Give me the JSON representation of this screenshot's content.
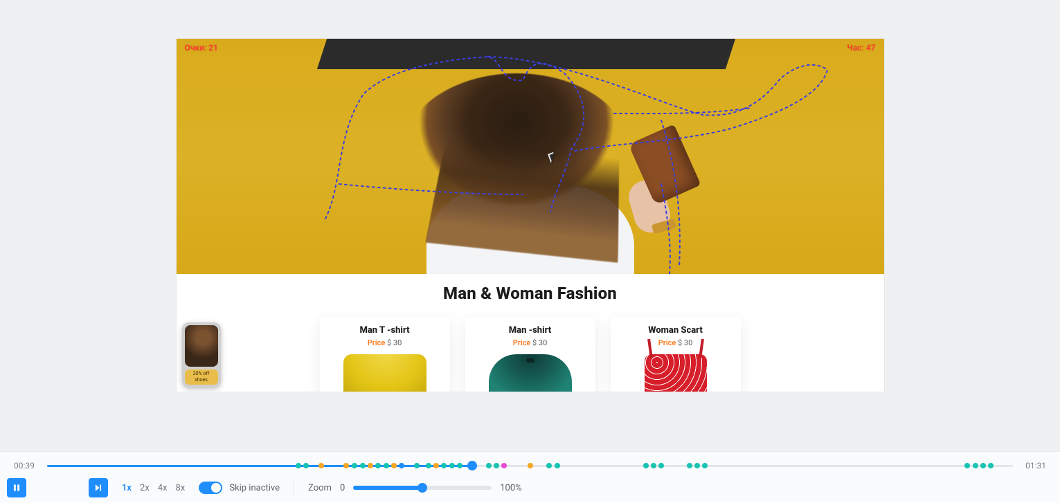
{
  "hero": {
    "overlay_top_left": "Очки: 21",
    "overlay_top_right": "Час: 47"
  },
  "section_title": "Man & Woman Fashion",
  "products": [
    {
      "title": "Man T -shirt",
      "price_label": "Price",
      "price_value": "$ 30",
      "swatch": "yellow"
    },
    {
      "title": "Man -shirt",
      "price_label": "Price",
      "price_value": "$ 30",
      "swatch": "green"
    },
    {
      "title": "Woman Scart",
      "price_label": "Price",
      "price_value": "$ 30",
      "swatch": "red"
    }
  ],
  "preview_thumb": {
    "line1": "20% off",
    "line2": "shoes"
  },
  "player": {
    "current_time": "00:39",
    "total_time": "01:31",
    "progress_pct": 44,
    "timeline_markers": [
      {
        "pct": 26.0,
        "c": "teal"
      },
      {
        "pct": 26.8,
        "c": "teal"
      },
      {
        "pct": 28.4,
        "c": "orange"
      },
      {
        "pct": 31.0,
        "c": "orange"
      },
      {
        "pct": 31.8,
        "c": "teal"
      },
      {
        "pct": 32.7,
        "c": "teal"
      },
      {
        "pct": 33.5,
        "c": "orange"
      },
      {
        "pct": 34.3,
        "c": "teal"
      },
      {
        "pct": 35.1,
        "c": "teal"
      },
      {
        "pct": 35.9,
        "c": "orange"
      },
      {
        "pct": 36.7,
        "c": "blue"
      },
      {
        "pct": 38.3,
        "c": "teal"
      },
      {
        "pct": 39.5,
        "c": "teal"
      },
      {
        "pct": 40.3,
        "c": "orange"
      },
      {
        "pct": 41.1,
        "c": "teal"
      },
      {
        "pct": 41.9,
        "c": "teal"
      },
      {
        "pct": 42.7,
        "c": "teal"
      },
      {
        "pct": 45.7,
        "c": "teal"
      },
      {
        "pct": 46.5,
        "c": "teal"
      },
      {
        "pct": 47.3,
        "c": "pink"
      },
      {
        "pct": 50.0,
        "c": "orange"
      },
      {
        "pct": 52.0,
        "c": "teal"
      },
      {
        "pct": 52.8,
        "c": "teal"
      },
      {
        "pct": 62.0,
        "c": "teal"
      },
      {
        "pct": 62.8,
        "c": "teal"
      },
      {
        "pct": 63.6,
        "c": "teal"
      },
      {
        "pct": 66.5,
        "c": "teal"
      },
      {
        "pct": 67.3,
        "c": "teal"
      },
      {
        "pct": 68.1,
        "c": "teal"
      },
      {
        "pct": 95.3,
        "c": "teal"
      },
      {
        "pct": 96.1,
        "c": "teal"
      },
      {
        "pct": 96.9,
        "c": "teal"
      },
      {
        "pct": 97.7,
        "c": "teal"
      }
    ],
    "speeds": [
      "1x",
      "2x",
      "4x",
      "8x"
    ],
    "speed_active_index": 0,
    "skip_inactive_label": "Skip inactive",
    "skip_inactive_on": true,
    "zoom_label": "Zoom",
    "zoom_min": "0",
    "zoom_max": "100%",
    "zoom_pct": 50
  }
}
